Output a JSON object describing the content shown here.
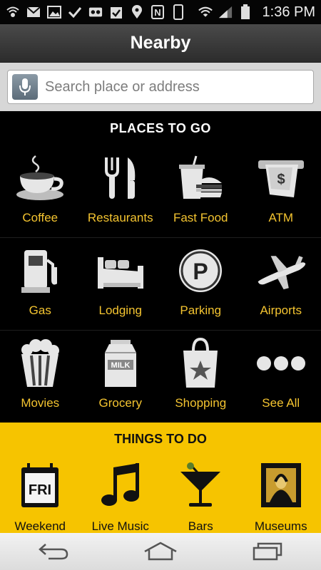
{
  "status_bar": {
    "time": "1:36 PM",
    "left_icons": [
      "wifi-calling-icon",
      "gmail-icon",
      "gallery-icon",
      "check-icon",
      "voicemail-icon",
      "tasks-icon",
      "location-icon",
      "nfc-icon",
      "phone-icon"
    ],
    "right_icons": [
      "wifi-icon",
      "signal-icon",
      "battery-icon"
    ]
  },
  "header": {
    "title": "Nearby"
  },
  "search": {
    "placeholder": "Search place or address",
    "value": ""
  },
  "places": {
    "title": "PLACES TO GO",
    "items": [
      {
        "label": "Coffee",
        "icon": "coffee-cup-icon"
      },
      {
        "label": "Restaurants",
        "icon": "fork-knife-icon"
      },
      {
        "label": "Fast Food",
        "icon": "fast-food-icon"
      },
      {
        "label": "ATM",
        "icon": "atm-icon"
      },
      {
        "label": "Gas",
        "icon": "gas-pump-icon"
      },
      {
        "label": "Lodging",
        "icon": "bed-icon"
      },
      {
        "label": "Parking",
        "icon": "parking-icon"
      },
      {
        "label": "Airports",
        "icon": "airplane-icon"
      },
      {
        "label": "Movies",
        "icon": "popcorn-icon"
      },
      {
        "label": "Grocery",
        "icon": "milk-carton-icon"
      },
      {
        "label": "Shopping",
        "icon": "shopping-bag-icon"
      },
      {
        "label": "See All",
        "icon": "more-dots-icon"
      }
    ],
    "milk_text": "MILK",
    "parking_text": "P",
    "atm_text": "$"
  },
  "things": {
    "title": "THINGS TO DO",
    "items": [
      {
        "label": "Weekend",
        "icon": "calendar-icon",
        "icon_text": "FRI"
      },
      {
        "label": "Live Music",
        "icon": "music-note-icon"
      },
      {
        "label": "Bars",
        "icon": "cocktail-icon"
      },
      {
        "label": "Museums",
        "icon": "painting-icon"
      }
    ]
  },
  "nav": {
    "buttons": [
      "back-icon",
      "home-icon",
      "recents-icon"
    ]
  },
  "colors": {
    "accent": "#f4c430",
    "things_bg": "#f6c400",
    "icon_gray": "#dcdcdc"
  }
}
